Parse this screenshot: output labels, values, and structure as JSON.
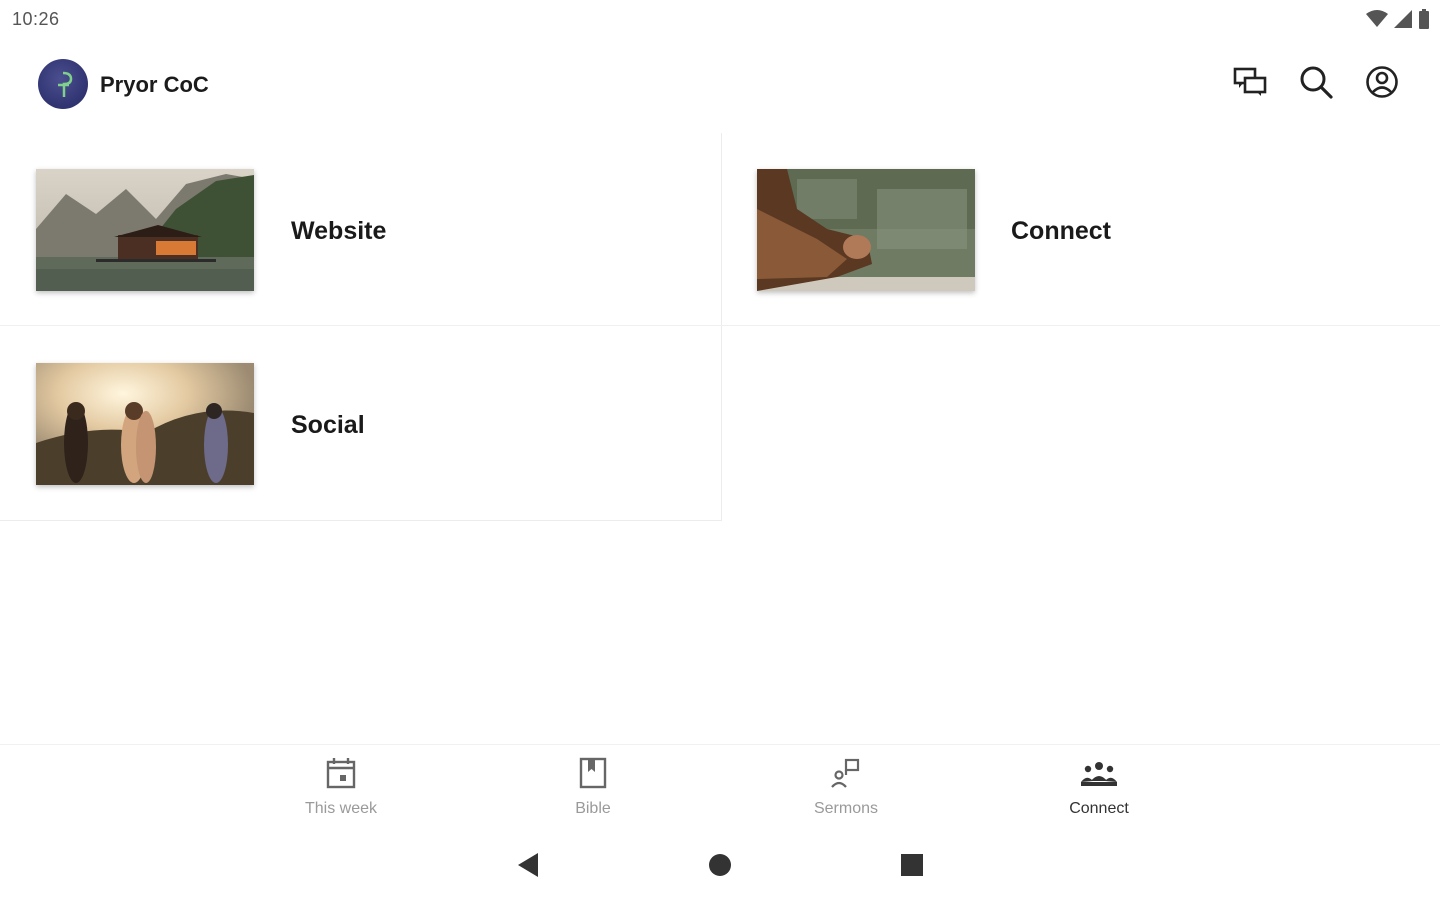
{
  "status": {
    "time": "10:26",
    "icons": [
      "wifi-icon",
      "cell-signal-icon",
      "battery-icon"
    ]
  },
  "app": {
    "title": "Pryor CoC",
    "logo_icon": "church-logo-icon",
    "actions": [
      "chat-icon",
      "search-icon",
      "account-icon"
    ]
  },
  "cards": [
    {
      "label": "Website",
      "image": "lake-cabin-mountains"
    },
    {
      "label": "Connect",
      "image": "praying-hands-lake"
    },
    {
      "label": "Social",
      "image": "friends-sunset-hills"
    }
  ],
  "bottom_nav": {
    "items": [
      {
        "label": "This week",
        "icon": "calendar-icon",
        "active": false
      },
      {
        "label": "Bible",
        "icon": "book-icon",
        "active": false
      },
      {
        "label": "Sermons",
        "icon": "sermon-icon",
        "active": false
      },
      {
        "label": "Connect",
        "icon": "group-icon",
        "active": true
      }
    ]
  },
  "system_nav": [
    "back-icon",
    "home-icon",
    "recents-icon"
  ],
  "colors": {
    "logo": "#2f3370",
    "text": "#1a1a1a",
    "nav_inactive": "#9a9a9a",
    "nav_active": "#333333"
  }
}
